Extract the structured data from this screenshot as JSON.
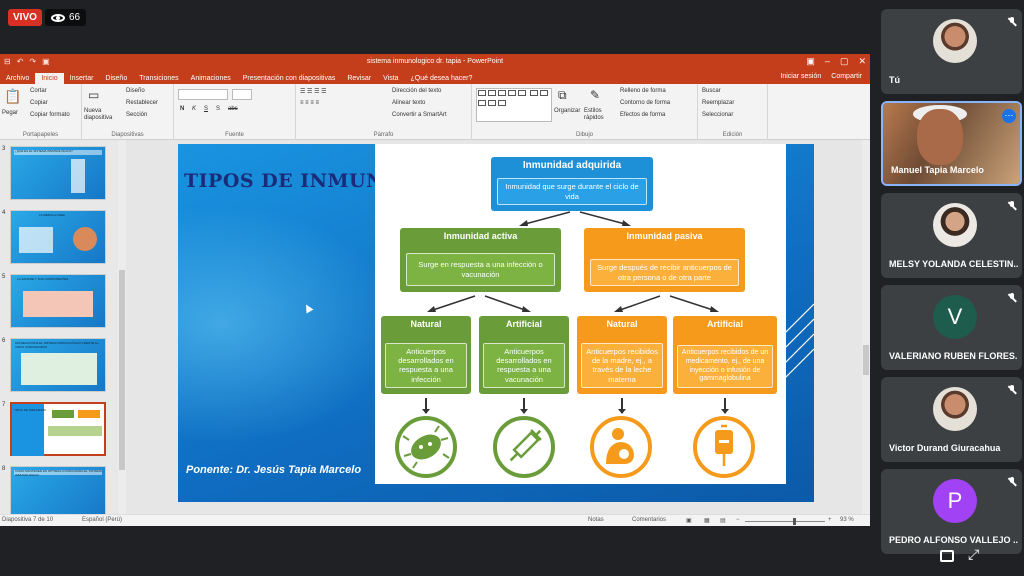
{
  "stream": {
    "live_label": "VIVO",
    "viewer_count": "66"
  },
  "window": {
    "title": "sistema inmunologico dr. tapia - PowerPoint",
    "qat": [
      "⊟",
      "↶",
      "↷",
      "▣"
    ],
    "tabs": [
      "Archivo",
      "Inicio",
      "Insertar",
      "Diseño",
      "Transiciones",
      "Animaciones",
      "Presentación con diapositivas",
      "Revisar",
      "Vista",
      "¿Qué desea hacer?"
    ],
    "signin": "Iniciar sesión",
    "share": "Compartir"
  },
  "ribbon": {
    "clipboard": {
      "paste": "Pegar",
      "cut": "Cortar",
      "copy": "Copiar",
      "format_painter": "Copiar formato",
      "label": "Portapapeles"
    },
    "slides": {
      "new_slide": "Nueva diapositiva",
      "layout": "Diseño",
      "reset": "Restablecer",
      "section": "Sección",
      "label": "Diapositivas"
    },
    "font": {
      "label": "Fuente",
      "bold": "N",
      "italic": "K",
      "underline": "S",
      "shadow": "S",
      "strike": "abc"
    },
    "paragraph": {
      "label": "Párrafo",
      "text_direction": "Dirección del texto",
      "align_text": "Alinear texto",
      "smartart": "Convertir a SmartArt"
    },
    "drawing": {
      "label": "Dibujo",
      "arrange": "Organizar",
      "quick_styles": "Estilos rápidos",
      "fill": "Relleno de forma",
      "outline": "Contorno de forma",
      "effects": "Efectos de forma"
    },
    "editing": {
      "label": "Edición",
      "find": "Buscar",
      "replace": "Reemplazar",
      "select": "Seleccionar"
    }
  },
  "thumbnails": [
    {
      "num": "3",
      "caption": "¿QUÉ ES EL SISTEMA INMUNOLÓGICO?"
    },
    {
      "num": "4",
      "caption": "LA MEDULA OSEA"
    },
    {
      "num": "5",
      "caption": "LA SANGRE Y SUS COMPONENTES"
    },
    {
      "num": "6",
      "caption": "ASÍ REACCIONA EL SISTEMA INMUNOLÓGICO FRENTE AL VIRUS CORONAVIRUS"
    },
    {
      "num": "7",
      "caption": "TIPOS DE INMUNIDAD"
    },
    {
      "num": "8",
      "caption": "COMO MANTENER EN OPTIMAS CONDICIONES EL SISTEMA INMUNOLOGICO"
    }
  ],
  "slide": {
    "title": "TIPOS DE INMUNIDAD",
    "footer": "Ponente: Dr. Jesús Tapia Marcelo",
    "top": {
      "header": "Inmunidad adquirida",
      "body": "Inmunidad que surge durante el ciclo de vida"
    },
    "active": {
      "header": "Inmunidad activa",
      "body": "Surge en respuesta a una infección o vacunación"
    },
    "passive": {
      "header": "Inmunidad pasiva",
      "body": "Surge después de recibir anticuerpos de otra persona o de otra parte"
    },
    "active_natural": {
      "header": "Natural",
      "body": "Anticuerpos desarrollados en respuesta a una infección"
    },
    "active_artificial": {
      "header": "Artificial",
      "body": "Anticuerpos desarrollados en respuesta a una vacunación"
    },
    "passive_natural": {
      "header": "Natural",
      "body": "Anticuerpos recibidos de la madre, ej., a través de la leche materna"
    },
    "passive_artificial": {
      "header": "Artificial",
      "body": "Anticuerpos recibidos de un medicamento, ej., de una inyección o infusión de gammaglobulina"
    },
    "icons": [
      "virus-icon",
      "syringe-icon",
      "mother-baby-icon",
      "iv-bag-icon"
    ],
    "colors": {
      "blue": "#1e90d8",
      "green": "#6a9d3a",
      "orange": "#f59a1b",
      "title": "#1a2b7a"
    }
  },
  "status": {
    "slide_info": "Diapositiva 7 de 10",
    "language": "Español (Perú)",
    "notes": "Notas",
    "comments": "Comentarios",
    "zoom": "93 %"
  },
  "participants": [
    {
      "name": "Tú",
      "avatar": "photo",
      "initial": ""
    },
    {
      "name": "Manuel Tapia Marcelo",
      "avatar": "video",
      "initial": ""
    },
    {
      "name": "MELSY YOLANDA CELESTIN...",
      "avatar": "photo",
      "initial": ""
    },
    {
      "name": "VALERIANO RUBEN FLORES...",
      "avatar": "letter",
      "initial": "V",
      "color": "#1e5c4d"
    },
    {
      "name": "Victor Durand Giuracahua",
      "avatar": "photo",
      "initial": ""
    },
    {
      "name": "PEDRO ALFONSO VALLEJO ...",
      "avatar": "letter",
      "initial": "P",
      "color": "#a142f4"
    }
  ]
}
